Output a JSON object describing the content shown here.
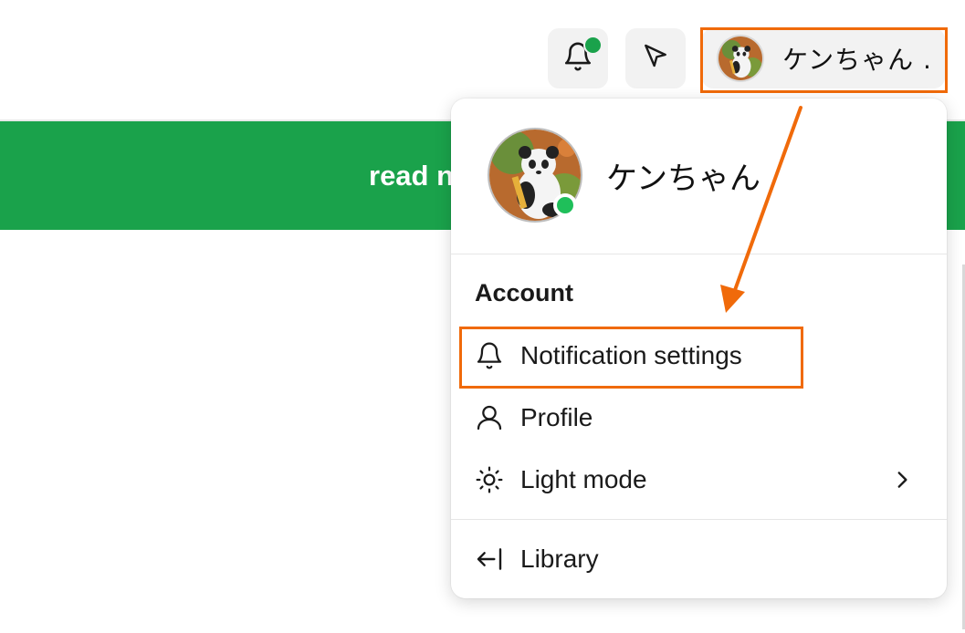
{
  "header": {
    "user_name": "ケンちゃん .",
    "bell_icon": "bell-icon",
    "send_icon": "send-icon",
    "has_unread": true
  },
  "banner": {
    "text": "read n",
    "color": "#1aa24b"
  },
  "dropdown": {
    "profile_name": "ケンちゃん",
    "online": true,
    "section_title": "Account",
    "items": [
      {
        "label": "Notification settings",
        "icon": "bell-icon"
      },
      {
        "label": "Profile",
        "icon": "user-icon"
      },
      {
        "label": "Light mode",
        "icon": "sun-icon",
        "has_submenu": true
      },
      {
        "label": "Library",
        "icon": "arrow-left-bar-icon"
      }
    ]
  },
  "colors": {
    "accent_green": "#1aa24b",
    "annotation_orange": "#f06a0a",
    "online_dot": "#1fbf5a"
  }
}
